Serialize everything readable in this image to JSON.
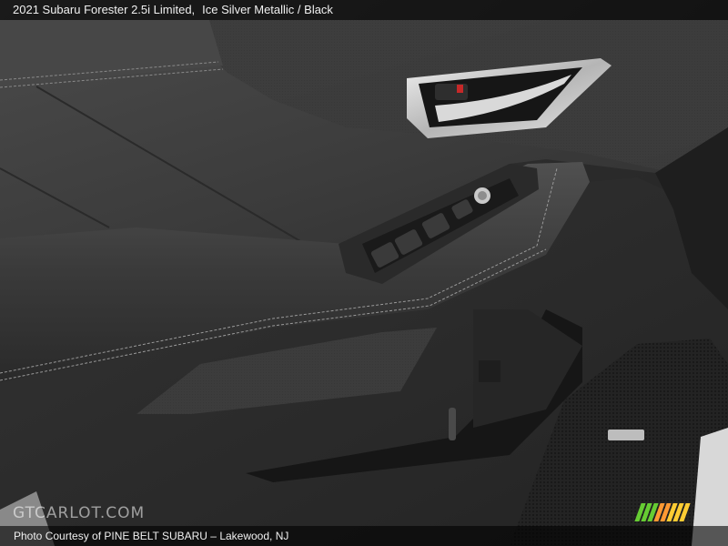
{
  "caption": {
    "vehicle": "2021 Subaru Forester 2.5i Limited,",
    "color": "Ice Silver Metallic / Black"
  },
  "watermark": {
    "text": "GTCARLOT.COM"
  },
  "credit": {
    "text": "Photo Courtesy of PINE BELT SUBARU – Lakewood, NJ"
  },
  "colors": {
    "caption_bar": "#000000",
    "logo_green": "#66cc33",
    "logo_orange": "#ff9933",
    "logo_yellow": "#ffcc33"
  }
}
